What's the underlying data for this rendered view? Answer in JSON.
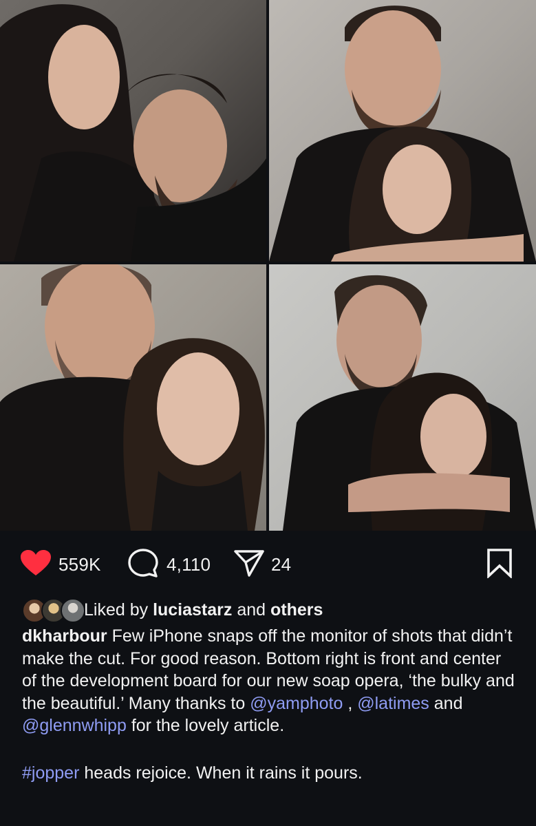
{
  "post": {
    "likes_count": "559K",
    "comments_count": "4,110",
    "shares_count": "24",
    "liked_by_prefix": "Liked by ",
    "liked_by_user": "luciastarz",
    "liked_by_and": " and ",
    "liked_by_others": "others",
    "caption": {
      "username": "dkharbour",
      "text_1": " Few iPhone snaps off the monitor of shots that didn’t make the cut.  For good reason.  Bottom right is front and center of the development board for our new soap opera, ‘the bulky and the beautiful.’ Many thanks to ",
      "mention_1": "@yamphoto",
      "sep_1": " , ",
      "mention_2": "@latimes",
      "sep_2": " and ",
      "mention_3": "@glennwhipp",
      "text_2": " for the lovely article.",
      "hashtag": "#jopper",
      "text_3": " heads rejoice.  When it rains it pours."
    }
  },
  "icons": {
    "like": "heart-icon",
    "comment": "comment-icon",
    "share": "send-icon",
    "save": "bookmark-icon"
  },
  "colors": {
    "background": "#0e1014",
    "like_red": "#ff2f40",
    "link_blue": "#8f9cf3",
    "text": "#f2f2f2"
  }
}
